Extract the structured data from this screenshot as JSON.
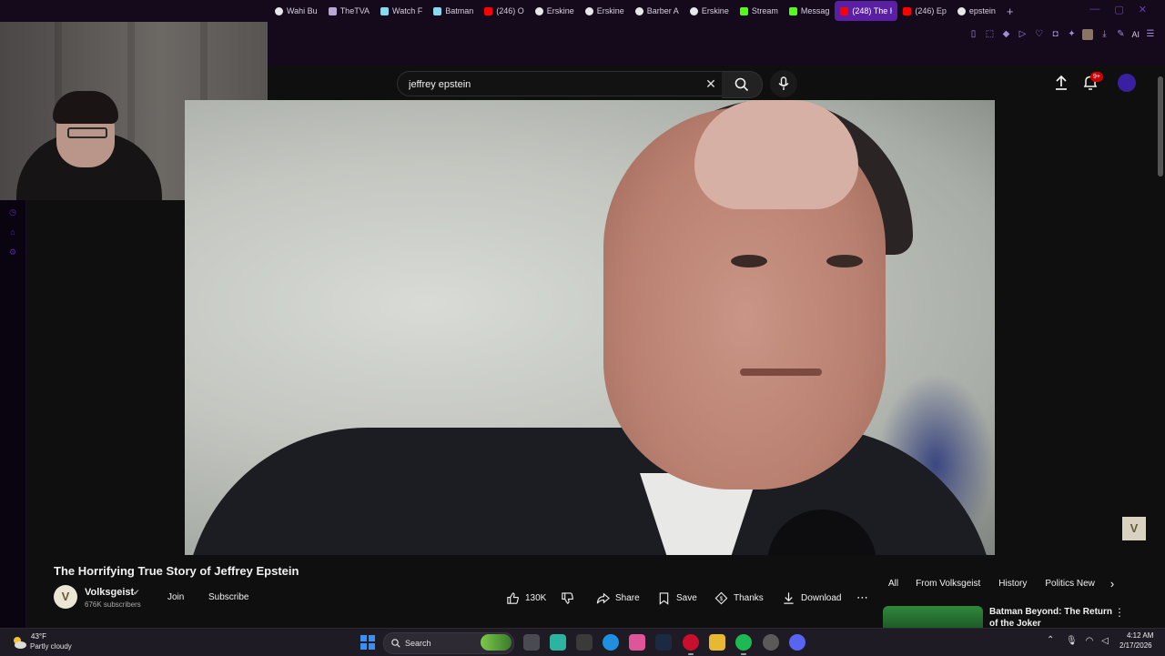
{
  "browser": {
    "tabs": [
      {
        "title": "Wahi Bu",
        "icon": "chrome-icon",
        "color": "#e8e8e8"
      },
      {
        "title": "TheTVA",
        "icon": "page-icon",
        "color": "#b9a6d8"
      },
      {
        "title": "Watch F",
        "icon": "page-icon",
        "color": "#8ad8f0"
      },
      {
        "title": "Batman",
        "icon": "page-icon",
        "color": "#8ad8f0"
      },
      {
        "title": "(246) O",
        "icon": "youtube-icon",
        "color": "#ff0000"
      },
      {
        "title": "Erskine",
        "icon": "chrome-icon",
        "color": "#e8e8e8"
      },
      {
        "title": "Erskine",
        "icon": "chrome-icon",
        "color": "#e8e8e8"
      },
      {
        "title": "Barber A",
        "icon": "chrome-icon",
        "color": "#e8e8e8"
      },
      {
        "title": "Erskine",
        "icon": "chrome-icon",
        "color": "#e8e8e8"
      },
      {
        "title": "Stream",
        "icon": "kick-icon",
        "color": "#53fc18"
      },
      {
        "title": "Messag",
        "icon": "kick-icon",
        "color": "#53fc18"
      },
      {
        "title": "(248) The H",
        "icon": "youtube-icon",
        "color": "#ff0000",
        "active": true
      },
      {
        "title": "(246) Ep",
        "icon": "youtube-icon",
        "color": "#ff0000"
      },
      {
        "title": "epstein",
        "icon": "google-icon",
        "color": "#e8e8e8"
      }
    ],
    "new_tab": "+",
    "ai_button": "AI"
  },
  "youtube": {
    "search": {
      "value": "jeffrey epstein",
      "placeholder": "Search"
    },
    "notifications_badge": "9+",
    "video": {
      "title": "The Horrifying True Story of Jeffrey Epstein",
      "watermark": "V"
    },
    "channel": {
      "name": "Volksgeist",
      "avatar_letter": "V",
      "verified": "✔",
      "subscribers": "676K subscribers",
      "join_label": "Join",
      "subscribe_label": "Subscribe"
    },
    "actions": {
      "likes": "130K",
      "share": "Share",
      "save": "Save",
      "thanks": "Thanks",
      "download": "Download",
      "more": "⋯"
    },
    "chips": [
      "All",
      "From Volksgeist",
      "History",
      "Politics New"
    ],
    "recommended": {
      "title": "Batman Beyond: The Return of the Joker"
    }
  },
  "taskbar": {
    "weather": {
      "temp": "43°F",
      "desc": "Partly cloudy"
    },
    "search_label": "Search",
    "clock": {
      "time": "4:12 AM",
      "date": "2/17/2026"
    },
    "apps": [
      {
        "name": "file-explorer-task-icon",
        "color": "#4a4a52"
      },
      {
        "name": "copilot-icon",
        "color": "#2bb5a0"
      },
      {
        "name": "terminal-icon",
        "color": "#3a3a3a"
      },
      {
        "name": "edge-icon",
        "color": "#1f8fe0"
      },
      {
        "name": "copilot-color-icon",
        "color": "#e0559a"
      },
      {
        "name": "steam-icon",
        "color": "#1b2a40"
      },
      {
        "name": "opera-gx-icon",
        "color": "#c8102e"
      },
      {
        "name": "folder-icon",
        "color": "#e8b830"
      },
      {
        "name": "spotify-icon",
        "color": "#1db954"
      },
      {
        "name": "chrome-task-icon",
        "color": "#5a5a5a"
      },
      {
        "name": "discord-icon",
        "color": "#5865f2"
      }
    ]
  }
}
